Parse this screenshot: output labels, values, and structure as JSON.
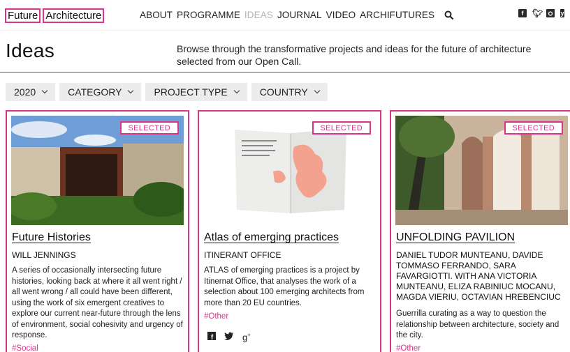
{
  "header": {
    "logo_part1": "Future",
    "logo_part2": "Architecture",
    "nav": [
      "ABOUT",
      "PROGRAMME",
      "IDEAS",
      "JOURNAL",
      "VIDEO",
      "ARCHIFUTURES"
    ],
    "active_nav": "IDEAS",
    "social_icons": [
      "facebook-icon",
      "twitter-icon",
      "instagram-icon",
      "youtube-icon"
    ]
  },
  "page": {
    "title": "Ideas",
    "intro": "Browse through the transformative projects and ideas for the future of architecture selected from our Open Call."
  },
  "filters": {
    "year": "2020",
    "category": "CATEGORY",
    "project_type": "PROJECT TYPE",
    "country": "COUNTRY"
  },
  "cards": [
    {
      "badge": "SELECTED",
      "title": "Future Histories",
      "authors": "WILL JENNINGS",
      "description": "A series of occasionally intersecting future histories, looking back at where it all went right / all went wrong / all could have been different, using the work of six emergent creatives to explore our current near-future through the lens of environment, social cohesivity and urgency of response.",
      "tag": "#Social"
    },
    {
      "badge": "SELECTED",
      "title": "Atlas of emerging practices",
      "authors": "ITINERANT OFFICE",
      "description": "ATLAS of emerging practices is a project by Itinernat Office, that analyses the work of a selection about 100 emerging architects from more than 20 EU countries.",
      "tag": "#Other",
      "share_icons": [
        "facebook-icon",
        "twitter-icon",
        "google-plus-icon"
      ]
    },
    {
      "badge": "SELECTED",
      "title": "UNFOLDING PAVILION",
      "authors": "DANIEL TUDOR MUNTEANU, DAVIDE TOMMASO FERRANDO, SARA FAVARGIOTTI. WITH ANA VICTORIA MUNTEANU, ELIZA RABINIUC MOCANU, MAGDA VIERIU, OCTAVIAN HREBENCIUC",
      "description": "Guerrilla curating as a way to question the relationship between architecture, society and the city.",
      "tag": "#Other"
    }
  ],
  "colors": {
    "accent": "#d7358a",
    "filter_bg": "#ececec",
    "nav_inactive": "#b5b5b5"
  }
}
